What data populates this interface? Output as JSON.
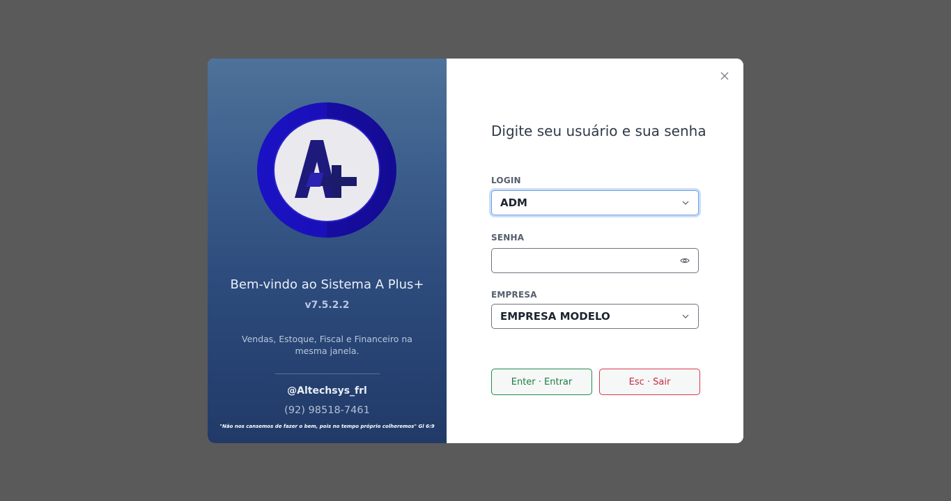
{
  "brand": {
    "logo_letter": "A",
    "welcome": "Bem-vindo ao Sistema A Plus+",
    "version": "v7.5.2.2",
    "tagline": "Vendas, Estoque, Fiscal e Financeiro na mesma janela.",
    "handle": "@Altechsys_frl",
    "phone": "(92) 98518-7461",
    "quote": "\"Não nos cansemos de fazer o bem, pois no tempo próprio colheremos\" Gl 6:9"
  },
  "form": {
    "heading": "Digite seu usuário e sua senha",
    "login": {
      "label": "LOGIN",
      "value": "ADM"
    },
    "senha": {
      "label": "SENHA",
      "value": ""
    },
    "empresa": {
      "label": "EMPRESA",
      "value": "EMPRESA MODELO"
    },
    "enter_label": "Enter · Entrar",
    "exit_label": "Esc · Sair"
  },
  "icons": {
    "close": "close-icon",
    "chevron": "chevron-down-icon",
    "eye": "eye-icon"
  },
  "colors": {
    "logo_ring": "#1a0fb8",
    "logo_letter": "#1c1a73",
    "enter_accent": "#1f8a4c",
    "exit_accent": "#d9374b",
    "focus": "#6aa0e6"
  }
}
